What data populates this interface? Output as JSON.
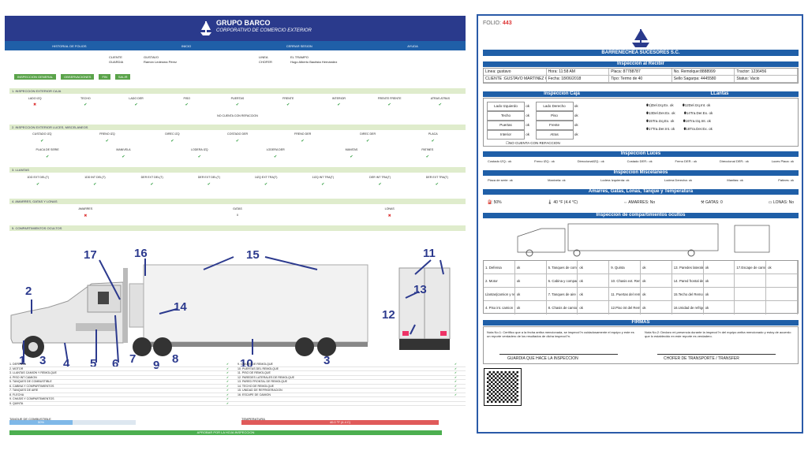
{
  "left_form": {
    "header_title": "GRUPO BARCO",
    "header_subtitle": "CORPORATIVO DE COMERCIO EXTERIOR",
    "nav": [
      "HISTORIAL DE FOLIOS",
      "INICIO",
      "CERRAR SESION",
      "AYUDA"
    ],
    "info": {
      "cliente_label": "CLIENTE",
      "cliente_value": "GUSTAVO",
      "guardia_label": "GUARDIA",
      "guardia_value": "Ramón Ledesma Pérez",
      "linea_label": "LINEA",
      "linea_value": "EL TRAMPO",
      "chofer_label": "CHOFER",
      "chofer_value": "Hugo Alberto Bautista Hernández"
    },
    "chips": [
      "INSPECCION GENERAL",
      "OBSERVACIONES",
      "FIN",
      "SALIR"
    ],
    "sections": {
      "s1": "1. INSPECCION EXTERIOR CAJA",
      "s2": "2. INSPECCION EXTERIOR LUCES, MISCELANEOS",
      "s3": "3. LLANTAS",
      "s4": "4. AMARRES, GATAS Y LONAS",
      "s5": "5. COMPARTIMIENTOS OCULTOS"
    },
    "caja_cols": [
      "LADO IZQ",
      "TECHO",
      "LADO DER",
      "PISO",
      "PUERTAS",
      "FRENTE",
      "INTERIOR",
      "FRENTE FRENTE",
      "ATRAS ATRAS"
    ],
    "no_refaccion": "NO CUENTA CON REFACCION",
    "luces_cols": [
      "CUSTADO IZQ",
      "FRENO IZQ",
      "DIREC IZQ",
      "COSTADO DER",
      "FRENO DER",
      "DIREC DER",
      "PLACA"
    ],
    "misc_cols": [
      "PLACA DE SERIE",
      "MANIVELA",
      "LODERA IZQ",
      "LODERA DER",
      "MANITAS",
      "PATINES"
    ],
    "llantas_cols": [
      "1DD EXT DEL(T)",
      "1DD INT DEL(T)",
      "DER EXT DEL(T)",
      "DER EXT DEL(T)",
      "1IZQ EXT TRA(T)",
      "1IZQ INT TRA(T)",
      "DER INT TRA(T)",
      "DER EXT TRA(T)"
    ],
    "amarres_cols": [
      "AMARRES",
      "GATAS",
      "LONAS"
    ],
    "amarres_vals": [
      "✖",
      "0",
      "✖"
    ],
    "truck_numbers": [
      "1",
      "2",
      "3",
      "4",
      "5",
      "6",
      "7",
      "8",
      "9",
      "10",
      "3",
      "11",
      "12",
      "13",
      "14",
      "15",
      "16",
      "17"
    ],
    "comp_left": [
      "1. DEFENSA",
      "2. MOTOR",
      "3. LLANTAS CAMION Y REMOLQUE",
      "4. PISO INT CAMION",
      "5. TANQUES DE COMBUSTIBLE",
      "6. CABINA Y COMPARTIMIENTOS",
      "7. TANQUES DE AIRE",
      "8. FLECHA",
      "9. CHASIS Y COMPARTIMIENTOS",
      "9. QUINTA"
    ],
    "comp_right": [
      "9. CHASIS DE REMOLQUE",
      "10. PUERTAS DEL REMOLQUE",
      "11. PISO DE REMOLQUE",
      "12. PAREDES LATERALES DE REMOLQUE",
      "13. PARED FRONTAL DE REMOLQUE",
      "14. TECHO DE REMOLQUE",
      "15. UNIDAD DE REFRIGERACION",
      "16. ESCAPE DE CAMION"
    ],
    "combustible_label": "TANQUE DE COMBUSTIBLE",
    "combustible_value": "50%",
    "temperatura_label": "TEMPERATURA",
    "temperatura_value": "40.0 °F (4.4 C)",
    "approve_label": "APROBAR POR LA HOJA INSPECCION"
  },
  "report": {
    "folio_label": "FOLIO:",
    "folio_value": "443",
    "company": "BARRENECHEA SUCESORES S.C.",
    "recibir_title": "Inspeccion al Recibir",
    "line1": [
      "Linea: gustavo",
      "Hora: 11:58 AM",
      "Placa: 87788787",
      "No. Remolque:8888999",
      "Tractor: 1236456"
    ],
    "line2": [
      "CLIENTE :GUSTAVO MARTINEZ GARCIA",
      "Fecha: 18/06/2018",
      "Tipo: Termo de 40",
      "Sello Sagarpa: 4445580",
      "Status: Vacio"
    ],
    "caja_title": "Inspeccion Caja",
    "llantas_title": "LLantas",
    "caja_items": [
      [
        "Lado Izquierdo",
        "ok",
        "Lado Derecho",
        "ok"
      ],
      [
        "Techo",
        "ok",
        "Piso",
        "ok"
      ],
      [
        "Puertas",
        "ok",
        "Frente",
        "ok"
      ],
      [
        "Interior",
        "ok",
        "Atras",
        "ok"
      ]
    ],
    "llantas_items": [
      [
        "1)Del.Izq.Ex. ok",
        "12Del.Izq.Int. ok"
      ],
      [
        "13Del.Der.Ex. ok",
        "14Tra.Der.Ex. ok"
      ],
      [
        "15Tra.Izq.Ex. ok",
        "16Tra.Izq.Int. ok"
      ],
      [
        "17Tra.Der.Int. ok",
        "18Tra.Der.Ex. ok"
      ]
    ],
    "refaccion": "NO CUENTA CON REFACCION",
    "luces_title": "Inspeccion Luces",
    "luces": [
      "Costado IZQ.: ok",
      "Freno IZQ.: ok",
      "DireccionalIZQ.: ok",
      "Costado DER.: ok",
      "Freno DER.: ok",
      "Direccional DER.: ok",
      "Luces Placa: ok"
    ],
    "misc_title": "Inspeccion Miscelaneos",
    "misc": [
      "Placa de serie: ok",
      "Manivela: ok",
      "Lodera Izquierda: ok",
      "Lodera Derecha: ok",
      "Manitas: ok",
      "Patines: ok"
    ],
    "amarres_title": "Amarres, Gatas, Lonas, Tanque y Temperatura",
    "amarres": [
      "50%",
      "40 °F (4.4 °C)",
      "AMARRES: No",
      "GATAS: 0",
      "LONAS: No"
    ],
    "ocultos_title": "Inspeccion de compartimientos ocultos",
    "ocultos": [
      [
        "1. Defensa",
        "ok",
        "5. Tanques de combustible",
        "ok",
        "9. Quinta",
        "ok",
        "13. Paredes laterales del Remolque",
        "ok",
        "17.Escape de camion",
        "ok"
      ],
      [
        "2. Motor",
        "ok",
        "6. Cabina y compartimientos",
        "ok",
        "10. Chasis ext. Remolque",
        "ok",
        "14. Pared frontal del Remolque",
        "ok",
        "",
        ""
      ],
      [
        "Llantas(camion y remolque)",
        "ok",
        "7. Tanques de aire",
        "ok",
        "11. Puertas del remolque",
        "ok",
        "15.Techo del Remolque",
        "ok",
        "",
        ""
      ],
      [
        "4. Piso int. camion",
        "ok",
        "8. Chasis de camion",
        "ok",
        "12.Piso int del Remolque",
        "ok",
        "16.Unidad de refrigeracion",
        "ok",
        "",
        ""
      ]
    ],
    "firmas_title": "FIRMAS",
    "nota1": "Nota No.1: Certifico que a la fecha arriba mencionada, se inspecci?n cuidadosamente el equipo y este es un reporte verdadero de los resultados de dicha inspecci?n.",
    "nota2": "Nota No.2: Declaro mi presencia durante la inspecci?n del equipo arriba mencionado y estoy de acuerdo que lo establecido en este reporte es verdadero.",
    "sig1": "GUARDIA QUE HACE LA INSPECCION",
    "sig2": "CHOFER DE TRANSPORTE / TRANSFER"
  }
}
